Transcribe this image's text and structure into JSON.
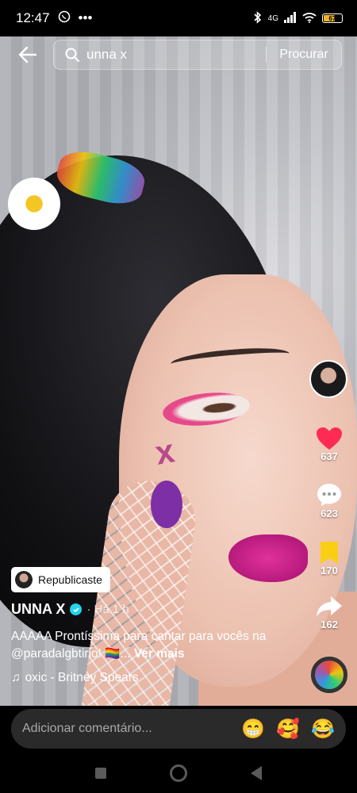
{
  "status": {
    "time": "12:47",
    "network": "4G",
    "battery": "67"
  },
  "search": {
    "query": "unna x",
    "button_label": "Procurar"
  },
  "rail": {
    "likes": "637",
    "comments": "623",
    "saves": "170",
    "shares": "162",
    "like_color": "#fe2c55",
    "save_color": "#face15"
  },
  "post": {
    "republish_label": "Republicaste",
    "author": "UNNA X",
    "time": "· Há 1 h",
    "caption": "AAAAA Prontíssima para cantar para vocês na @paradalgbtirio! 🏳️‍🌈...",
    "more_label": "Ver mais",
    "music": "oxic - Britney Spears"
  },
  "comment": {
    "placeholder": "Adicionar comentário...",
    "emojis": [
      "😁",
      "🥰",
      "😂"
    ]
  }
}
